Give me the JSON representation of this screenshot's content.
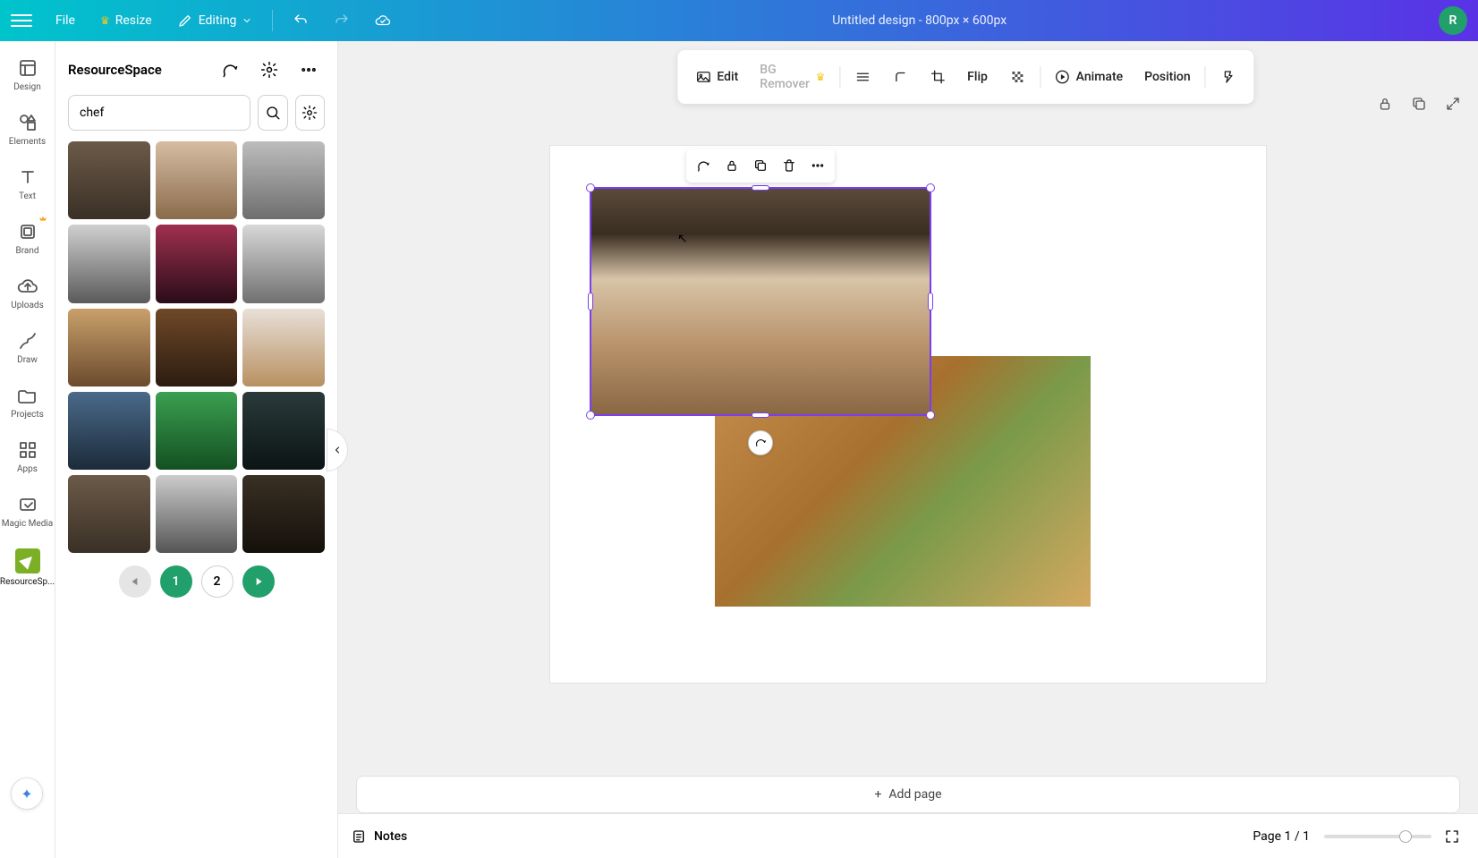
{
  "topbar": {
    "file": "File",
    "resize": "Resize",
    "editing": "Editing",
    "title": "Untitled design - 800px × 600px",
    "avatar_letter": "R"
  },
  "rail": {
    "design": "Design",
    "elements": "Elements",
    "text": "Text",
    "brand": "Brand",
    "uploads": "Uploads",
    "draw": "Draw",
    "projects": "Projects",
    "apps": "Apps",
    "magic_media": "Magic Media",
    "resourcespace": "ResourceSp..."
  },
  "panel": {
    "title": "ResourceSpace",
    "search_value": "chef",
    "search_placeholder": "Search"
  },
  "pager": {
    "page1": "1",
    "page2": "2"
  },
  "context_toolbar": {
    "edit": "Edit",
    "bg_remover": "BG Remover",
    "flip": "Flip",
    "animate": "Animate",
    "position": "Position"
  },
  "canvas": {
    "add_page": "Add page"
  },
  "bottom": {
    "notes": "Notes",
    "page_indicator": "Page 1 / 1"
  },
  "thumbs": {
    "colors": [
      "linear-gradient(#6b5a48,#3a3026)",
      "linear-gradient(#d6bda2,#8a6b4c)",
      "linear-gradient(#bdbdbd,#6e6e6e)",
      "linear-gradient(#d0d0d0,#5a5a5a)",
      "linear-gradient(#a03050,#2a0c18)",
      "linear-gradient(#d8d8d8,#707070)",
      "linear-gradient(#c9a06b,#6b4b2d)",
      "linear-gradient(#704828,#2b1c10)",
      "linear-gradient(#e8e0d8,#b89060)",
      "linear-gradient(#4a6a8a,#1c2b3a)",
      "linear-gradient(#3aa050,#145022)",
      "linear-gradient(#2a3a3a,#0c1414)",
      "linear-gradient(#6b5a48,#3a3026)",
      "linear-gradient(#cccccc,#555555)",
      "linear-gradient(#3a3024,#14100a)"
    ]
  }
}
